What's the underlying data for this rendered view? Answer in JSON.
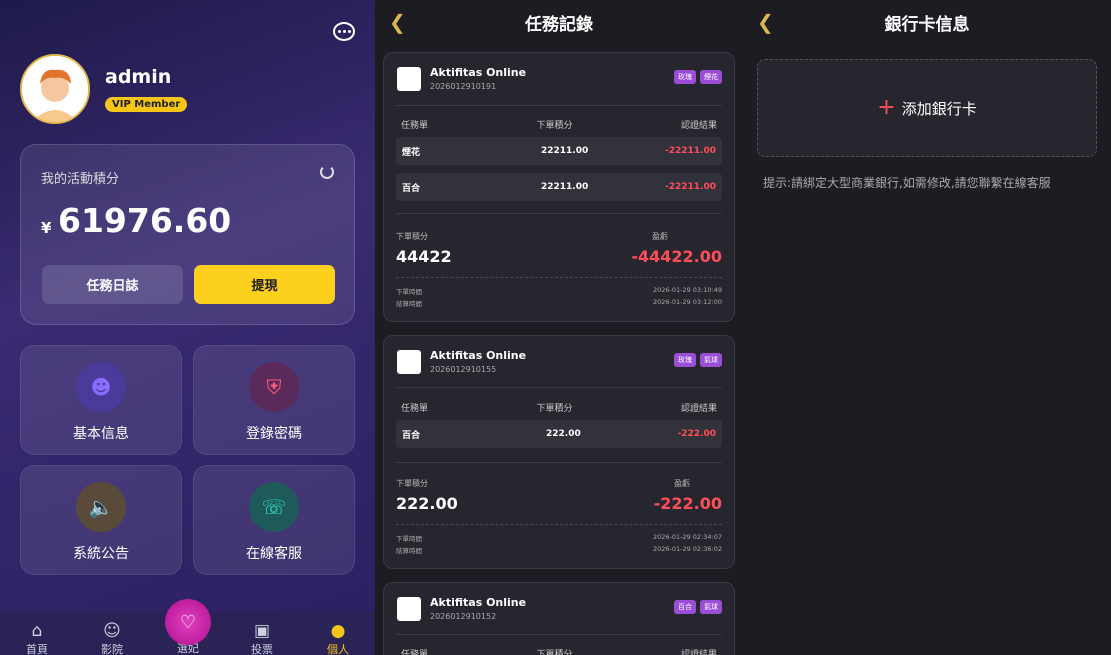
{
  "profile": {
    "username": "admin",
    "badge": "VIP Member"
  },
  "balance_card": {
    "title": "我的活動積分",
    "currency": "¥",
    "amount": "61976.60",
    "log_button": "任務日誌",
    "withdraw_button": "提現"
  },
  "tiles": [
    {
      "label": "基本信息",
      "icon": "user-icon"
    },
    {
      "label": "登錄密碼",
      "icon": "shield-icon"
    },
    {
      "label": "系統公告",
      "icon": "speaker-icon"
    },
    {
      "label": "在線客服",
      "icon": "headset-icon"
    }
  ],
  "tabbar": [
    {
      "label": "首頁",
      "icon": "home-icon"
    },
    {
      "label": "影院",
      "icon": "smile-icon"
    },
    {
      "label": "選妃",
      "icon": "heart-icon"
    },
    {
      "label": "投票",
      "icon": "gamepad-icon"
    },
    {
      "label": "個人",
      "icon": "person-icon"
    }
  ],
  "records_header": {
    "title": "任務記錄"
  },
  "records": [
    {
      "name": "Aktifitas Online",
      "id": "2026012910191",
      "tags": [
        "玫瑰",
        "煙花"
      ],
      "col1": "任務單",
      "col2": "下單積分",
      "col3": "認證結果",
      "rows": [
        {
          "item": "煙花",
          "points": "22211.00",
          "result": "-22211.00"
        },
        {
          "item": "百合",
          "points": "22211.00",
          "result": "-22211.00"
        }
      ],
      "order_label": "下單積分",
      "order_total": "44422",
      "profit_label": "盈虧",
      "profit": "-44422.00",
      "order_time_label": "下單時間",
      "order_time": "2026-01-29 03:10:49",
      "settle_time_label": "結算時間",
      "settle_time": "2026-01-29 03:12:00"
    },
    {
      "name": "Aktifitas Online",
      "id": "2026012910155",
      "tags": [
        "玫瑰",
        "氣球"
      ],
      "col1": "任務單",
      "col2": "下單積分",
      "col3": "認證結果",
      "rows": [
        {
          "item": "百合",
          "points": "222.00",
          "result": "-222.00"
        }
      ],
      "order_label": "下單積分",
      "order_total": "222.00",
      "profit_label": "盈虧",
      "profit": "-222.00",
      "order_time_label": "下單時間",
      "order_time": "2026-01-29 02:34:07",
      "settle_time_label": "結算時間",
      "settle_time": "2026-01-29 02:36:02"
    },
    {
      "name": "Aktifitas Online",
      "id": "2026012910152",
      "tags": [
        "百合",
        "氣球"
      ],
      "col1": "任務單",
      "col2": "下單積分",
      "col3": "認證結果"
    }
  ],
  "bank_header": {
    "title": "銀行卡信息"
  },
  "bank": {
    "add_label": "添加銀行卡",
    "hint": "提示:請綁定大型商業銀行,如需修改,請您聯繫在線客服"
  },
  "colors": {
    "accent": "#fcd01d",
    "loss": "#ff4d5a",
    "tag": "#9c4dd8"
  }
}
